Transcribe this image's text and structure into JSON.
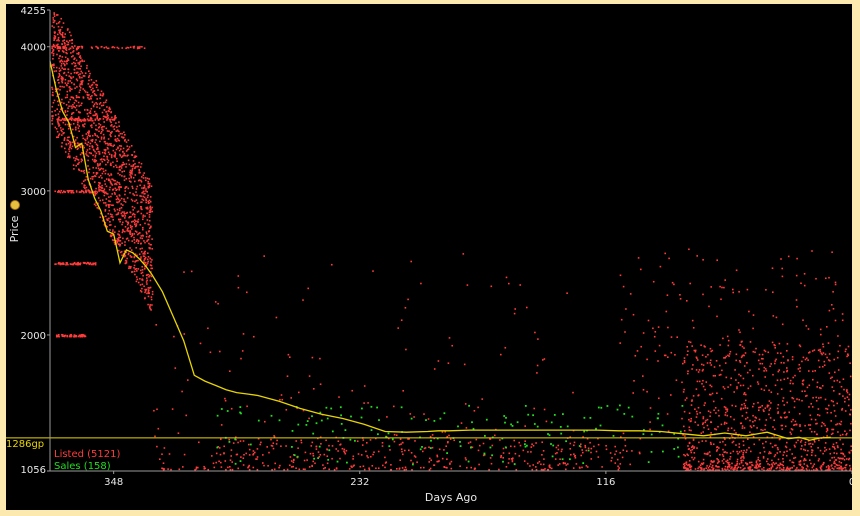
{
  "chart_data": {
    "type": "scatter",
    "xlabel": "Days Ago",
    "ylabel": "Price",
    "xlim": [
      378,
      0
    ],
    "ylim": [
      1056,
      4255
    ],
    "x_ticks": [
      "348",
      "232",
      "116",
      "0"
    ],
    "y_ticks": [
      "4255",
      "4000",
      "3000",
      "2000",
      "1056"
    ],
    "reference_line": {
      "label": "1286gp",
      "value": 1286
    },
    "legend": [
      {
        "label": "Listed (5121)",
        "color": "#ff3b3b"
      },
      {
        "label": "Sales (158)",
        "color": "#22dd22"
      }
    ],
    "average_line": {
      "color": "#e8d400",
      "x": [
        378,
        375,
        372,
        369,
        366,
        363,
        360,
        357,
        354,
        351,
        348,
        345,
        342,
        339,
        336,
        333,
        330,
        325,
        320,
        315,
        310,
        305,
        300,
        295,
        290,
        285,
        280,
        270,
        260,
        250,
        240,
        230,
        220,
        210,
        200,
        195,
        190,
        180,
        170,
        160,
        150,
        140,
        130,
        120,
        110,
        100,
        90,
        80,
        70,
        60,
        50,
        40,
        30,
        25,
        20,
        15,
        10
      ],
      "y": [
        3900,
        3700,
        3550,
        3470,
        3300,
        3330,
        3080,
        2950,
        2860,
        2720,
        2700,
        2500,
        2590,
        2570,
        2530,
        2480,
        2420,
        2300,
        2130,
        1960,
        1720,
        1680,
        1650,
        1620,
        1600,
        1590,
        1580,
        1540,
        1490,
        1450,
        1420,
        1380,
        1330,
        1325,
        1330,
        1335,
        1335,
        1340,
        1340,
        1340,
        1340,
        1340,
        1340,
        1340,
        1335,
        1335,
        1330,
        1315,
        1300,
        1320,
        1300,
        1325,
        1280,
        1290,
        1270,
        1285,
        1290
      ]
    }
  }
}
